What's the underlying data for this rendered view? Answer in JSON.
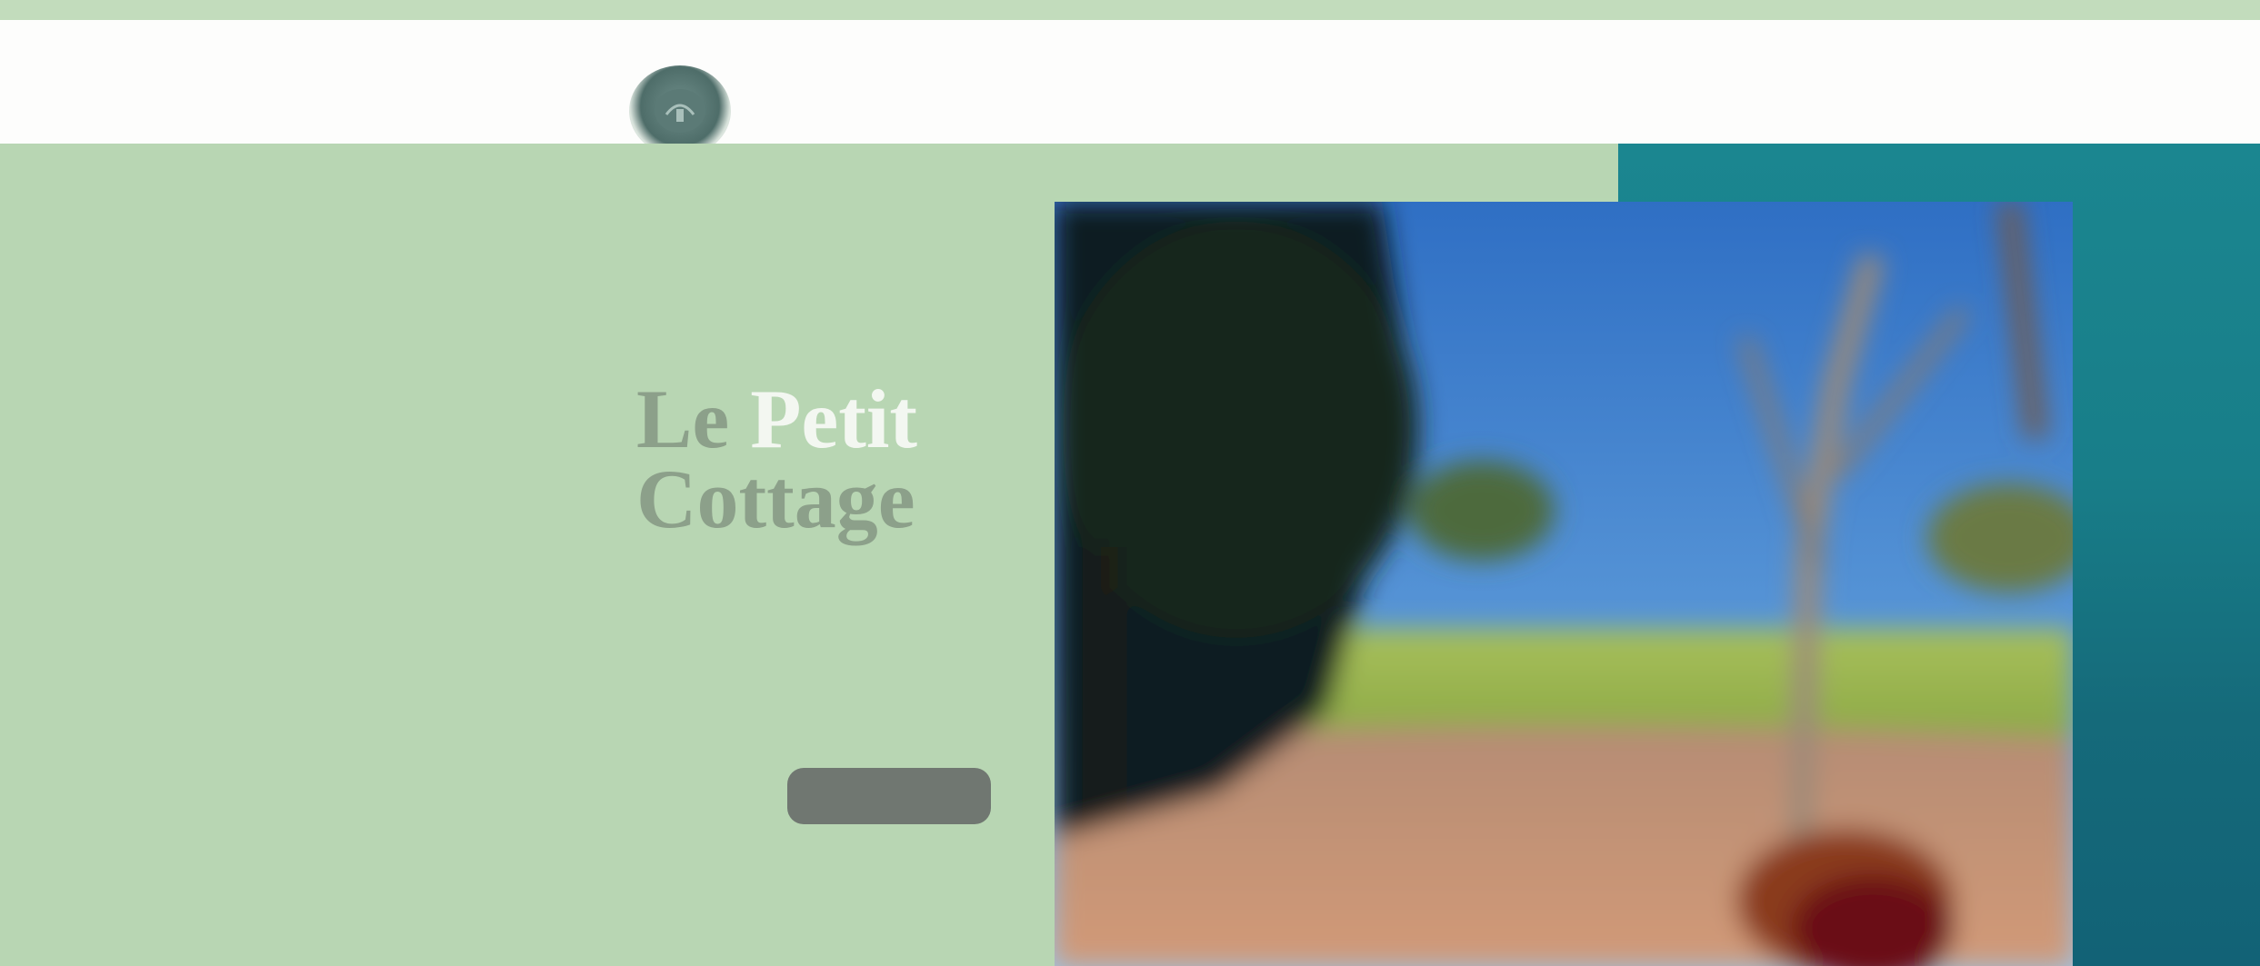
{
  "header": {
    "logo_icon": "circular-crest-logo",
    "nav": [
      "",
      "",
      "",
      "",
      ""
    ]
  },
  "hero": {
    "eyebrow": "",
    "title_lead": "Le",
    "title_highlight": "Petit",
    "title_rest": "Cottage",
    "description": "",
    "cta_label": ""
  },
  "colors": {
    "hero_green": "#b8d6b3",
    "teal": "#187e89",
    "header_bg": "#fdfdfc",
    "button_bg": "#707771"
  },
  "image": {
    "icon": "garden-landscape-photo"
  }
}
